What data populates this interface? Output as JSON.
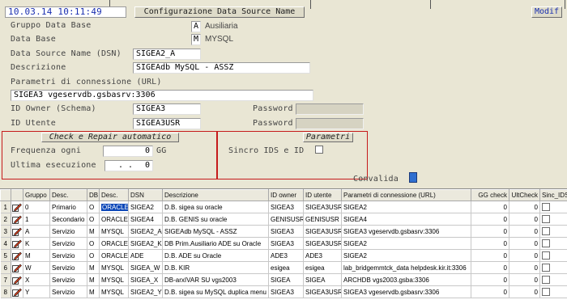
{
  "header": {
    "datetime": "10.03.14 10:11:49",
    "title": "Configurazione Data Source Name",
    "mode": "Modif"
  },
  "form": {
    "gruppo_label": "Gruppo Data Base",
    "gruppo_code": "A",
    "gruppo_desc": "Ausiliaria",
    "database_label": "Data Base",
    "database_code": "M",
    "database_desc": "MYSQL",
    "dsn_label": "Data Source Name (DSN)",
    "dsn_value": "SIGEA2_A",
    "descrizione_label": "Descrizione",
    "descrizione_value": "SIGEAdb MySQL - ASSZ",
    "parametri_label": "Parametri di connessione (URL)",
    "parametri_value": "SIGEA3 vgeservdb.gsbasrv:3306",
    "id_owner_label": "ID Owner (Schema)",
    "id_owner_value": "SIGEA3",
    "password_label": "Password",
    "id_utente_label": "ID Utente",
    "id_utente_value": "SIGEA3USR",
    "password2_label": "Password"
  },
  "check_repair": {
    "title": "Check e Repair automatico",
    "frequenza_label": "Frequenza ogni",
    "frequenza_value": "0",
    "frequenza_unit": "GG",
    "ultima_label": "Ultima esecuzione",
    "ultima_date": ". .",
    "ultima_value": "0"
  },
  "parametri_box": {
    "title": "Parametri",
    "sincro_label": "Sincro IDS e ID"
  },
  "convalida_label": "Convalida",
  "grid": {
    "headers": [
      "",
      "",
      "Gruppo",
      "Desc.",
      "DB",
      "Desc.",
      "DSN",
      "Descrizione",
      "ID owner",
      "ID utente",
      "Parametri di connessione (URL)",
      "GG check",
      "UltCheck",
      "Sinc_IDS"
    ],
    "rows": [
      {
        "n": "1",
        "gruppo": "0",
        "gdesc": "Primario",
        "db": "O",
        "dbdesc": "ORACLE",
        "dsn": "SIGEA2",
        "descr": "D.B. sigea su oracle",
        "owner": "SIGEA3",
        "utente": "SIGEA3USR",
        "url": "SIGEA2",
        "gg": "0",
        "ult": "0"
      },
      {
        "n": "2",
        "gruppo": "1",
        "gdesc": "Secondario",
        "db": "O",
        "dbdesc": "ORACLE",
        "dsn": "SIGEA4",
        "descr": "D.B. GENIS su oracle",
        "owner": "GENISUSR",
        "utente": "GENISUSR",
        "url": "SIGEA4",
        "gg": "0",
        "ult": "0"
      },
      {
        "n": "3",
        "gruppo": "A",
        "gdesc": "Servizio",
        "db": "M",
        "dbdesc": "MYSQL",
        "dsn": "SIGEA2_A",
        "descr": "SIGEAdb MySQL - ASSZ",
        "owner": "SIGEA3",
        "utente": "SIGEA3USR",
        "url": "SIGEA3 vgeservdb.gsbasrv:3306",
        "gg": "0",
        "ult": "0"
      },
      {
        "n": "4",
        "gruppo": "K",
        "gdesc": "Servizio",
        "db": "O",
        "dbdesc": "ORACLE",
        "dsn": "SIGEA2_K",
        "descr": "DB Prim.Ausiliario ADE su Oracle",
        "owner": "SIGEA3",
        "utente": "SIGEA3USR",
        "url": "SIGEA2",
        "gg": "0",
        "ult": "0"
      },
      {
        "n": "5",
        "gruppo": "M",
        "gdesc": "Servizio",
        "db": "O",
        "dbdesc": "ORACLE",
        "dsn": "ADE",
        "descr": "D.B. ADE su Oracle",
        "owner": "ADE3",
        "utente": "ADE3",
        "url": "SIGEA2",
        "gg": "0",
        "ult": "0"
      },
      {
        "n": "6",
        "gruppo": "W",
        "gdesc": "Servizio",
        "db": "M",
        "dbdesc": "MYSQL",
        "dsn": "SIGEA_W",
        "descr": "D.B. KIR",
        "owner": "esigea",
        "utente": "esigea",
        "url": "lab_bridgemmtck_data helpdesk.kir.it:3306",
        "gg": "0",
        "ult": "0"
      },
      {
        "n": "7",
        "gruppo": "X",
        "gdesc": "Servizio",
        "db": "M",
        "dbdesc": "MYSQL",
        "dsn": "SIGEA_X",
        "descr": "DB-arxIVAR SU vgs2003",
        "owner": "SIGEA",
        "utente": "SIGEA",
        "url": "ARCHDB vgs2003.gsba:3306",
        "gg": "0",
        "ult": "0"
      },
      {
        "n": "8",
        "gruppo": "Y",
        "gdesc": "Servizio",
        "db": "M",
        "dbdesc": "MYSQL",
        "dsn": "SIGEA2_Y",
        "descr": "D.B. sigea su MySQL duplica menu",
        "owner": "SIGEA3",
        "utente": "SIGEA3USR",
        "url": "SIGEA3 vgeservdb.gsbasrv:3306",
        "gg": "0",
        "ult": "0"
      }
    ]
  }
}
